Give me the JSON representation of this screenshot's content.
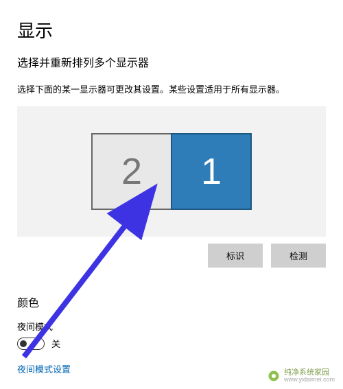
{
  "page": {
    "title": "显示",
    "subtitle": "选择并重新排列多个显示器",
    "description": "选择下面的某一显示器可更改其设置。某些设置适用于所有显示器。"
  },
  "monitors": {
    "left_label": "2",
    "right_label": "1"
  },
  "buttons": {
    "identify": "标识",
    "detect": "检测"
  },
  "color_section": {
    "header": "颜色",
    "night_light_label": "夜间模式",
    "toggle_state": "关",
    "settings_link": "夜间模式设置"
  },
  "watermark": {
    "title": "纯净系统家园",
    "url": "www.yidaimei.com"
  },
  "colors": {
    "selected_monitor": "#2e7cb8",
    "arrow": "#3d33e3"
  }
}
